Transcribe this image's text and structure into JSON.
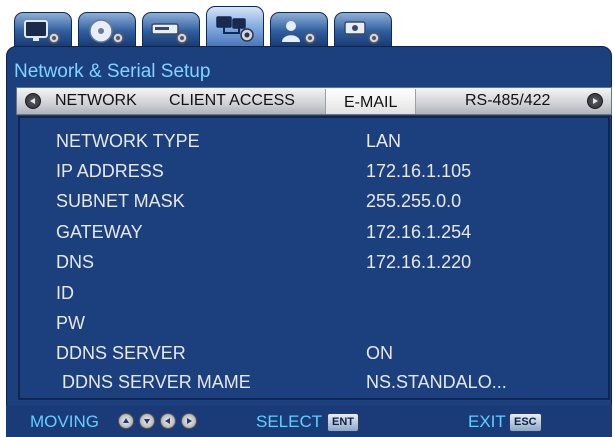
{
  "tabs": [
    {
      "icon": "monitor-settings-icon"
    },
    {
      "icon": "disc-settings-icon"
    },
    {
      "icon": "recorder-settings-icon"
    },
    {
      "icon": "network-settings-icon",
      "active": true
    },
    {
      "icon": "user-settings-icon"
    },
    {
      "icon": "camera-settings-icon"
    }
  ],
  "window": {
    "title": "Network & Serial Setup"
  },
  "subtabs": [
    {
      "label": "NETWORK"
    },
    {
      "label": "CLIENT ACCESS"
    },
    {
      "label": "E-MAIL",
      "selected": true
    },
    {
      "label": "RS-485/422"
    }
  ],
  "settings": [
    {
      "label": "NETWORK TYPE",
      "value": "LAN"
    },
    {
      "label": "IP ADDRESS",
      "value": "172.16.1.105"
    },
    {
      "label": "SUBNET MASK",
      "value": "255.255.0.0"
    },
    {
      "label": "GATEWAY",
      "value": "172.16.1.254"
    },
    {
      "label": "DNS",
      "value": "172.16.1.220"
    },
    {
      "label": "ID",
      "value": ""
    },
    {
      "label": "PW",
      "value": ""
    },
    {
      "label": "DDNS SERVER",
      "value": "ON"
    },
    {
      "label": "DDNS SERVER MAME",
      "value": "NS.STANDALO..."
    }
  ],
  "footer": {
    "moving_label": "MOVING",
    "select_label": "SELECT",
    "select_key": "ENT",
    "exit_label": "EXIT",
    "exit_key": "ESC"
  },
  "colors": {
    "background": "#1c3f7d",
    "title_text": "#7fd6ff",
    "row_text": "#e6e9ee",
    "footer_text": "#5fd0ff"
  }
}
